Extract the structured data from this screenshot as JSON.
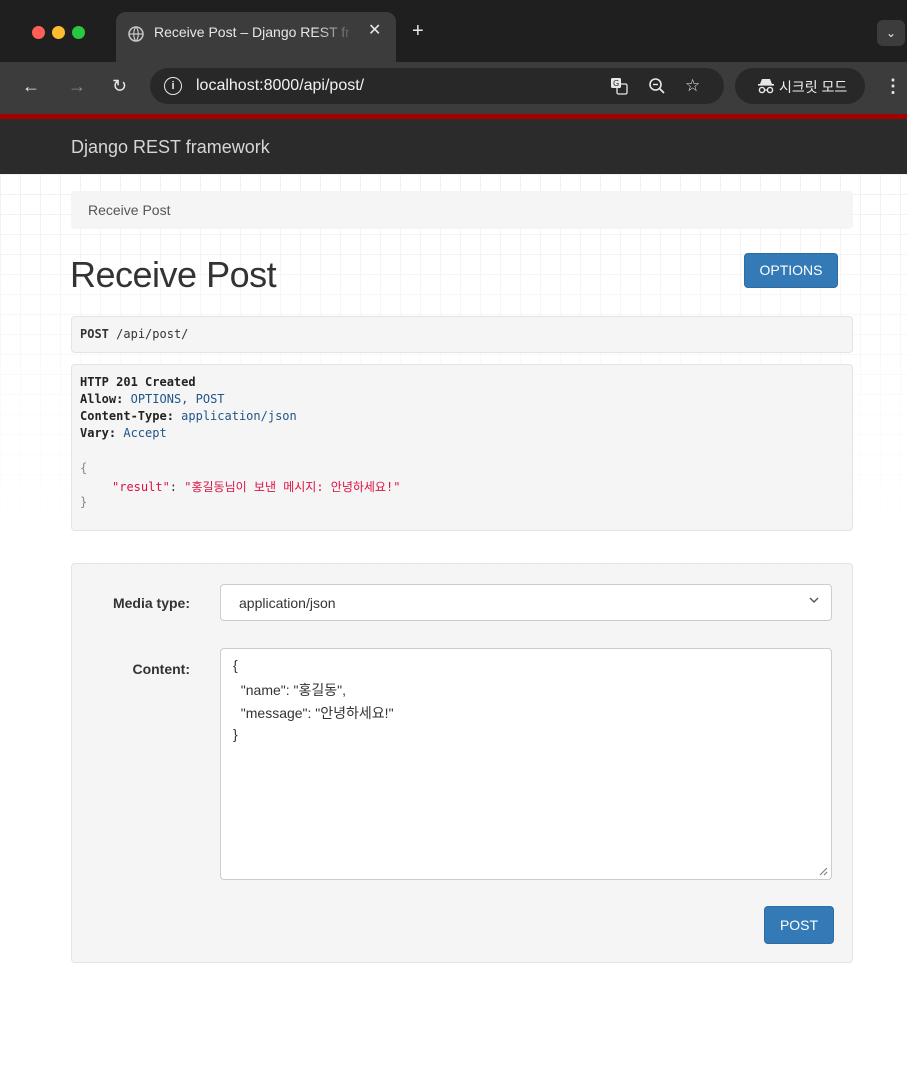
{
  "browser": {
    "tab_title": "Receive Post – Django REST framework",
    "tab_close": "✕",
    "new_tab": "+",
    "tab_menu": "⌄",
    "url": "localhost:8000/api/post/",
    "incognito_label": "시크릿 모드",
    "icons": [
      "globe-icon",
      "back-icon",
      "forward-icon",
      "reload-icon",
      "info-icon",
      "translate-icon",
      "zoom-icon",
      "star-icon",
      "incognito-icon",
      "kebab-menu-icon"
    ]
  },
  "navbar": {
    "brand": "Django REST framework"
  },
  "breadcrumb": {
    "item": "Receive Post"
  },
  "page": {
    "title": "Receive Post",
    "options_button": "OPTIONS"
  },
  "request": {
    "method": "POST",
    "path": "/api/post/"
  },
  "response": {
    "status": "HTTP 201 Created",
    "headers": [
      {
        "key": "Allow:",
        "value": "OPTIONS, POST"
      },
      {
        "key": "Content-Type:",
        "value": "application/json"
      },
      {
        "key": "Vary:",
        "value": "Accept"
      }
    ],
    "body_open": "{",
    "body_key": "\"result\"",
    "body_sep": ": ",
    "body_value": "\"홍길동님이 보낸 메시지: 안녕하세요!\"",
    "body_close": "}"
  },
  "form": {
    "media_type_label": "Media type:",
    "media_type_value": "application/json",
    "content_label": "Content:",
    "content_lines": [
      "{",
      "  \"name\": \"홍길동\",",
      "  \"message\": \"안녕하세요!\"",
      "}"
    ],
    "post_button": "POST"
  },
  "colors": {
    "primary": "#337ab7",
    "navbar": "#2b2b2b",
    "accent_red": "#a30000",
    "json_string": "#dd1144",
    "header_value": "#225588"
  }
}
